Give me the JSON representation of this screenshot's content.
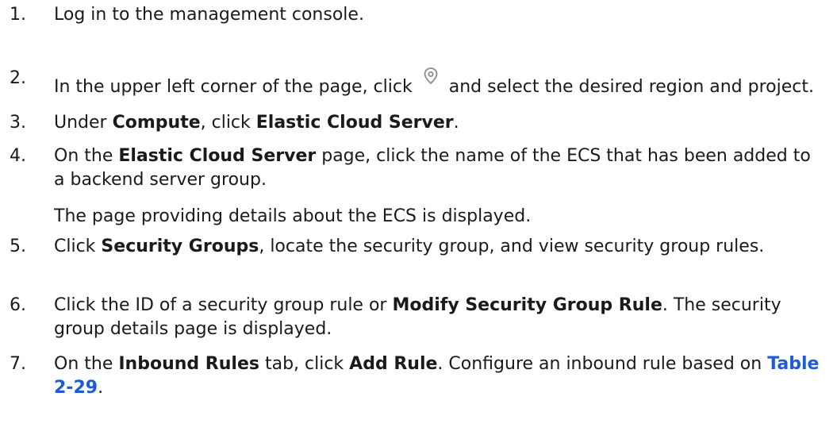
{
  "steps": [
    {
      "num": "1.",
      "text": "Log in to the management console."
    },
    {
      "num": "2.",
      "before": "In the upper left corner of the page, click",
      "icon": "location-pin-icon",
      "after": "and select the desired region and project."
    },
    {
      "num": "3.",
      "t1": "Under ",
      "b1": "Compute",
      "t2": ", click ",
      "b2": "Elastic Cloud Server",
      "t3": "."
    },
    {
      "num": "4.",
      "t1": "On the ",
      "b1": "Elastic Cloud Server",
      "t2": " page, click the name of the ECS that has been added to a backend server group.",
      "sub": "The page providing details about the ECS is displayed."
    },
    {
      "num": "5.",
      "t1": "Click ",
      "b1": "Security Groups",
      "t2": ", locate the security group, and view security group rules."
    },
    {
      "num": "6.",
      "t1": "Click the ID of a security group rule or ",
      "b1": "Modify Security Group Rule",
      "t2": ". The security group details page is displayed."
    },
    {
      "num": "7.",
      "t1": "On the ",
      "b1": "Inbound Rules",
      "t2": " tab, click ",
      "b2": "Add Rule",
      "t3": ". Configure an inbound rule based on ",
      "link": "Table 2-29",
      "t4": "."
    }
  ]
}
